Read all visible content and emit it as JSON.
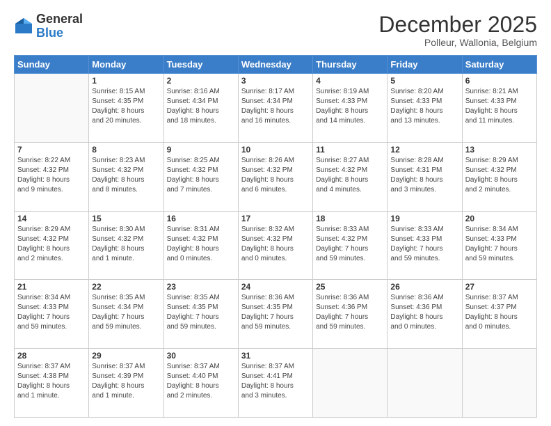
{
  "logo": {
    "general": "General",
    "blue": "Blue"
  },
  "header": {
    "month": "December 2025",
    "location": "Polleur, Wallonia, Belgium"
  },
  "weekdays": [
    "Sunday",
    "Monday",
    "Tuesday",
    "Wednesday",
    "Thursday",
    "Friday",
    "Saturday"
  ],
  "weeks": [
    [
      {
        "day": "",
        "info": ""
      },
      {
        "day": "1",
        "info": "Sunrise: 8:15 AM\nSunset: 4:35 PM\nDaylight: 8 hours\nand 20 minutes."
      },
      {
        "day": "2",
        "info": "Sunrise: 8:16 AM\nSunset: 4:34 PM\nDaylight: 8 hours\nand 18 minutes."
      },
      {
        "day": "3",
        "info": "Sunrise: 8:17 AM\nSunset: 4:34 PM\nDaylight: 8 hours\nand 16 minutes."
      },
      {
        "day": "4",
        "info": "Sunrise: 8:19 AM\nSunset: 4:33 PM\nDaylight: 8 hours\nand 14 minutes."
      },
      {
        "day": "5",
        "info": "Sunrise: 8:20 AM\nSunset: 4:33 PM\nDaylight: 8 hours\nand 13 minutes."
      },
      {
        "day": "6",
        "info": "Sunrise: 8:21 AM\nSunset: 4:33 PM\nDaylight: 8 hours\nand 11 minutes."
      }
    ],
    [
      {
        "day": "7",
        "info": "Sunrise: 8:22 AM\nSunset: 4:32 PM\nDaylight: 8 hours\nand 9 minutes."
      },
      {
        "day": "8",
        "info": "Sunrise: 8:23 AM\nSunset: 4:32 PM\nDaylight: 8 hours\nand 8 minutes."
      },
      {
        "day": "9",
        "info": "Sunrise: 8:25 AM\nSunset: 4:32 PM\nDaylight: 8 hours\nand 7 minutes."
      },
      {
        "day": "10",
        "info": "Sunrise: 8:26 AM\nSunset: 4:32 PM\nDaylight: 8 hours\nand 6 minutes."
      },
      {
        "day": "11",
        "info": "Sunrise: 8:27 AM\nSunset: 4:32 PM\nDaylight: 8 hours\nand 4 minutes."
      },
      {
        "day": "12",
        "info": "Sunrise: 8:28 AM\nSunset: 4:31 PM\nDaylight: 8 hours\nand 3 minutes."
      },
      {
        "day": "13",
        "info": "Sunrise: 8:29 AM\nSunset: 4:32 PM\nDaylight: 8 hours\nand 2 minutes."
      }
    ],
    [
      {
        "day": "14",
        "info": "Sunrise: 8:29 AM\nSunset: 4:32 PM\nDaylight: 8 hours\nand 2 minutes."
      },
      {
        "day": "15",
        "info": "Sunrise: 8:30 AM\nSunset: 4:32 PM\nDaylight: 8 hours\nand 1 minute."
      },
      {
        "day": "16",
        "info": "Sunrise: 8:31 AM\nSunset: 4:32 PM\nDaylight: 8 hours\nand 0 minutes."
      },
      {
        "day": "17",
        "info": "Sunrise: 8:32 AM\nSunset: 4:32 PM\nDaylight: 8 hours\nand 0 minutes."
      },
      {
        "day": "18",
        "info": "Sunrise: 8:33 AM\nSunset: 4:32 PM\nDaylight: 7 hours\nand 59 minutes."
      },
      {
        "day": "19",
        "info": "Sunrise: 8:33 AM\nSunset: 4:33 PM\nDaylight: 7 hours\nand 59 minutes."
      },
      {
        "day": "20",
        "info": "Sunrise: 8:34 AM\nSunset: 4:33 PM\nDaylight: 7 hours\nand 59 minutes."
      }
    ],
    [
      {
        "day": "21",
        "info": "Sunrise: 8:34 AM\nSunset: 4:33 PM\nDaylight: 7 hours\nand 59 minutes."
      },
      {
        "day": "22",
        "info": "Sunrise: 8:35 AM\nSunset: 4:34 PM\nDaylight: 7 hours\nand 59 minutes."
      },
      {
        "day": "23",
        "info": "Sunrise: 8:35 AM\nSunset: 4:35 PM\nDaylight: 7 hours\nand 59 minutes."
      },
      {
        "day": "24",
        "info": "Sunrise: 8:36 AM\nSunset: 4:35 PM\nDaylight: 7 hours\nand 59 minutes."
      },
      {
        "day": "25",
        "info": "Sunrise: 8:36 AM\nSunset: 4:36 PM\nDaylight: 7 hours\nand 59 minutes."
      },
      {
        "day": "26",
        "info": "Sunrise: 8:36 AM\nSunset: 4:36 PM\nDaylight: 8 hours\nand 0 minutes."
      },
      {
        "day": "27",
        "info": "Sunrise: 8:37 AM\nSunset: 4:37 PM\nDaylight: 8 hours\nand 0 minutes."
      }
    ],
    [
      {
        "day": "28",
        "info": "Sunrise: 8:37 AM\nSunset: 4:38 PM\nDaylight: 8 hours\nand 1 minute."
      },
      {
        "day": "29",
        "info": "Sunrise: 8:37 AM\nSunset: 4:39 PM\nDaylight: 8 hours\nand 1 minute."
      },
      {
        "day": "30",
        "info": "Sunrise: 8:37 AM\nSunset: 4:40 PM\nDaylight: 8 hours\nand 2 minutes."
      },
      {
        "day": "31",
        "info": "Sunrise: 8:37 AM\nSunset: 4:41 PM\nDaylight: 8 hours\nand 3 minutes."
      },
      {
        "day": "",
        "info": ""
      },
      {
        "day": "",
        "info": ""
      },
      {
        "day": "",
        "info": ""
      }
    ]
  ]
}
